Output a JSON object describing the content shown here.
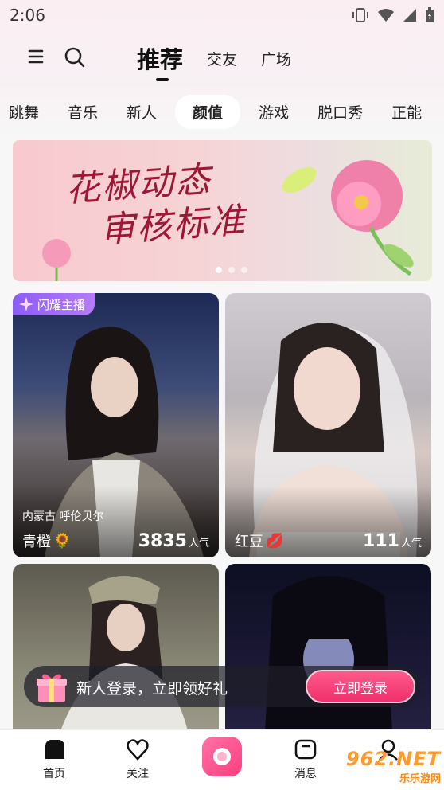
{
  "status_bar": {
    "time": "2:06"
  },
  "header": {
    "tabs": [
      {
        "label": "推荐",
        "active": true
      },
      {
        "label": "交友",
        "active": false
      },
      {
        "label": "广场",
        "active": false
      }
    ]
  },
  "categories": [
    "跳舞",
    "音乐",
    "新人",
    "颜值",
    "游戏",
    "脱口秀",
    "正能"
  ],
  "active_category": "颜值",
  "banner": {
    "line1": "花椒动态",
    "line2": "审核标准",
    "dot_count": 3,
    "active_dot": 0
  },
  "cards": [
    {
      "badge": "闪耀主播",
      "location": "内蒙古 呼伦贝尔",
      "name": "青橙",
      "name_emoji": "🌻",
      "popularity": "3835",
      "popularity_unit": "人气"
    },
    {
      "name": "红豆",
      "name_emoji": "💋",
      "popularity": "111",
      "popularity_unit": "人气"
    },
    {},
    {}
  ],
  "login_prompt": {
    "text": "新人登录，立即领好礼",
    "button": "立即登录"
  },
  "bottom_nav": [
    {
      "label": "首页",
      "icon": "home-icon"
    },
    {
      "label": "关注",
      "icon": "heart-icon"
    },
    {
      "label": "",
      "icon": "camera-icon"
    },
    {
      "label": "消息",
      "icon": "message-icon"
    },
    {
      "label": "",
      "icon": "profile-icon"
    }
  ],
  "watermark": {
    "logo": "962.NET",
    "sub": "乐乐游网"
  },
  "colors": {
    "accent": "#ff3d7f",
    "badge": "#8c5cf6",
    "banner_text": "#a01736"
  }
}
